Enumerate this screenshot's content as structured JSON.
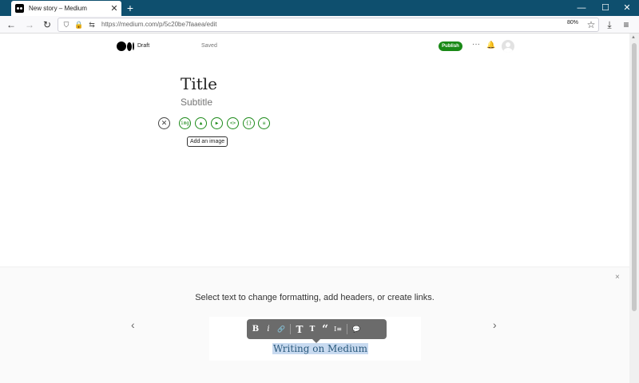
{
  "browser": {
    "tab_title": "New story – Medium",
    "tab_close": "✕",
    "new_tab": "+",
    "url": "https://medium.com/p/5c20be7faaea/edit",
    "zoom": "80%",
    "controls": {
      "minimize": "—",
      "maximize": "☐",
      "close": "✕"
    },
    "nav": {
      "back": "←",
      "forward": "→",
      "reload": "↻"
    },
    "toolbar": {
      "bookmark": "☆",
      "downloads": "⤓",
      "menu": "≡"
    }
  },
  "header": {
    "status": "Draft",
    "save_state": "Saved",
    "publish_label": "Publish",
    "more_label": "···",
    "bell": "🔔"
  },
  "editor": {
    "title_placeholder": "Title",
    "subtitle_placeholder": "Subtitle",
    "close_symbol": "✕",
    "insert_buttons": [
      "img",
      "▲",
      "▶",
      "<>",
      "{}",
      "≡"
    ],
    "tooltip": "Add an image"
  },
  "onboarding": {
    "close": "×",
    "text": "Select text to change formatting, add headers, or create links.",
    "prev": "‹",
    "next": "›",
    "toolbar_icons": [
      "B",
      "i",
      "🔗",
      "T",
      "T",
      "“",
      "I≡",
      "💬"
    ],
    "demo_text": "Writing on Medium"
  },
  "colors": {
    "accent": "#1a8917",
    "chrome": "#0e4f6e",
    "highlight": "#c8daf0"
  }
}
